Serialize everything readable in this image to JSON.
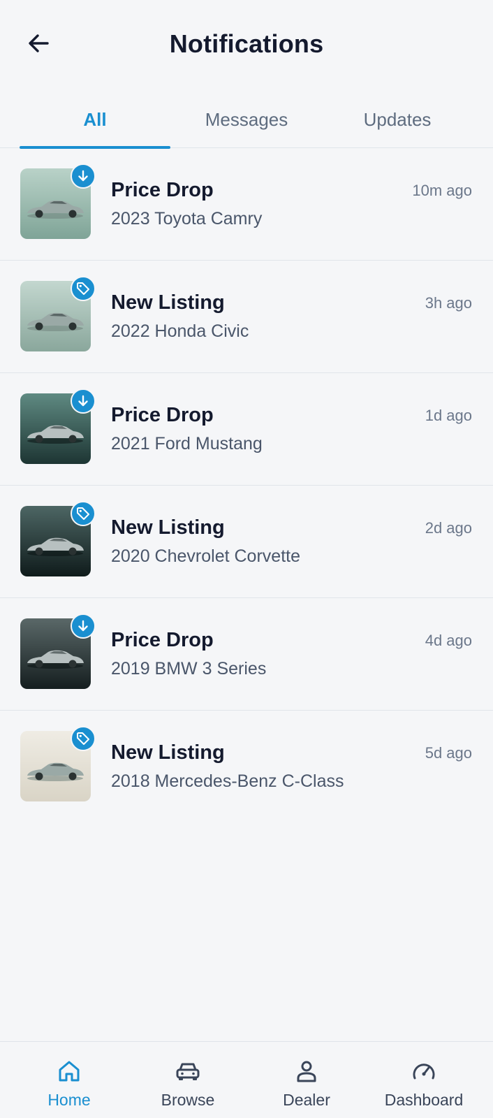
{
  "header": {
    "title": "Notifications",
    "back_icon": "arrow-left-icon"
  },
  "tabs": [
    {
      "label": "All",
      "active": true
    },
    {
      "label": "Messages",
      "active": false
    },
    {
      "label": "Updates",
      "active": false
    }
  ],
  "notifications": [
    {
      "type": "price-drop",
      "badge_icon": "arrow-down-icon",
      "title": "Price Drop",
      "subtitle": "2023 Toyota Camry",
      "time": "10m ago",
      "thumb_colors": [
        "#b9d2c8",
        "#7fa497"
      ]
    },
    {
      "type": "new-listing",
      "badge_icon": "tag-icon",
      "title": "New Listing",
      "subtitle": "2022 Honda Civic",
      "time": "3h ago",
      "thumb_colors": [
        "#c3d7cf",
        "#8aa79c"
      ]
    },
    {
      "type": "price-drop",
      "badge_icon": "arrow-down-icon",
      "title": "Price Drop",
      "subtitle": "2021 Ford Mustang",
      "time": "1d ago",
      "thumb_colors": [
        "#5f8a82",
        "#1d3533"
      ]
    },
    {
      "type": "new-listing",
      "badge_icon": "tag-icon",
      "title": "New Listing",
      "subtitle": "2020 Chevrolet Corvette",
      "time": "2d ago",
      "thumb_colors": [
        "#4d6664",
        "#0f1b1b"
      ]
    },
    {
      "type": "price-drop",
      "badge_icon": "arrow-down-icon",
      "title": "Price Drop",
      "subtitle": "2019 BMW 3 Series",
      "time": "4d ago",
      "thumb_colors": [
        "#5a6868",
        "#151e1f"
      ]
    },
    {
      "type": "new-listing",
      "badge_icon": "tag-icon",
      "title": "New Listing",
      "subtitle": "2018 Mercedes-Benz C-Class",
      "time": "5d ago",
      "thumb_colors": [
        "#efece4",
        "#d9d4c6"
      ]
    }
  ],
  "bottom_nav": [
    {
      "label": "Home",
      "icon": "home-icon",
      "active": true
    },
    {
      "label": "Browse",
      "icon": "car-icon",
      "active": false
    },
    {
      "label": "Dealer",
      "icon": "person-icon",
      "active": false
    },
    {
      "label": "Dashboard",
      "icon": "speedometer-icon",
      "active": false
    }
  ],
  "colors": {
    "accent": "#1a8fd0",
    "background": "#f5f6f8",
    "text_primary": "#141a2e",
    "text_secondary": "#4a566a"
  }
}
